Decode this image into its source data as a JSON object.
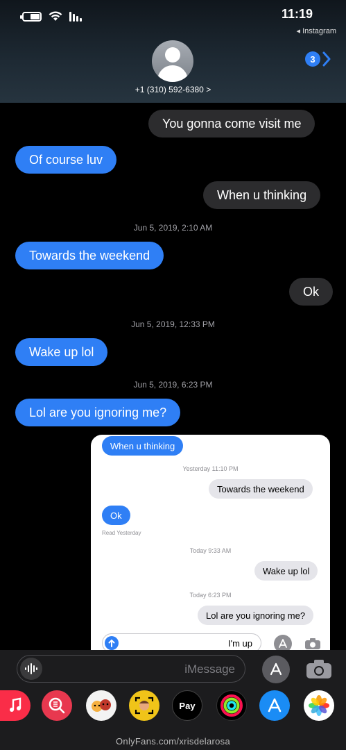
{
  "status_bar": {
    "time": "11:19",
    "back_app": "◂ Instagram"
  },
  "header": {
    "unread_count": "3",
    "contact": "+1 (310) 592-6380 >"
  },
  "messages": [
    {
      "text": "You gonna come visit me"
    },
    {
      "text": "Of course luv"
    },
    {
      "text": "When u thinking"
    },
    {
      "timestamp": "Jun 5, 2019, 2:10 AM"
    },
    {
      "text": "Towards the weekend"
    },
    {
      "text": "Ok"
    },
    {
      "timestamp": "Jun 5, 2019, 12:33 PM"
    },
    {
      "text": "Wake up lol"
    },
    {
      "timestamp": "Jun 5, 2019, 6:23 PM"
    },
    {
      "text": "Lol are you ignoring me?"
    }
  ],
  "screenshot": {
    "messages": [
      {
        "text": "When u thinking"
      },
      {
        "timestamp": "Yesterday 11:10 PM"
      },
      {
        "text": "Towards the weekend"
      },
      {
        "text": "Ok"
      },
      {
        "read": "Read Yesterday"
      },
      {
        "timestamp": "Today 9:33 AM"
      },
      {
        "text": "Wake up lol"
      },
      {
        "timestamp": "Today 6:23 PM"
      },
      {
        "text": "Lol are you ignoring me?"
      }
    ],
    "input_value": "I'm up"
  },
  "input_bar": {
    "placeholder": "iMessage"
  },
  "app_drawer": {
    "apps": [
      "photos-app",
      "app-store-app",
      "activity-app",
      "apple-pay-app",
      "memoji-camera-app",
      "animoji-app",
      "search-images-app",
      "music-app"
    ],
    "apple_pay_label": "Pay"
  },
  "watermark": "OnlyFans.com/xrisdelarosa",
  "colors": {
    "imessage_blue": "#2f7ff5",
    "received_gray": "#2c2c2e",
    "background": "#000000"
  }
}
